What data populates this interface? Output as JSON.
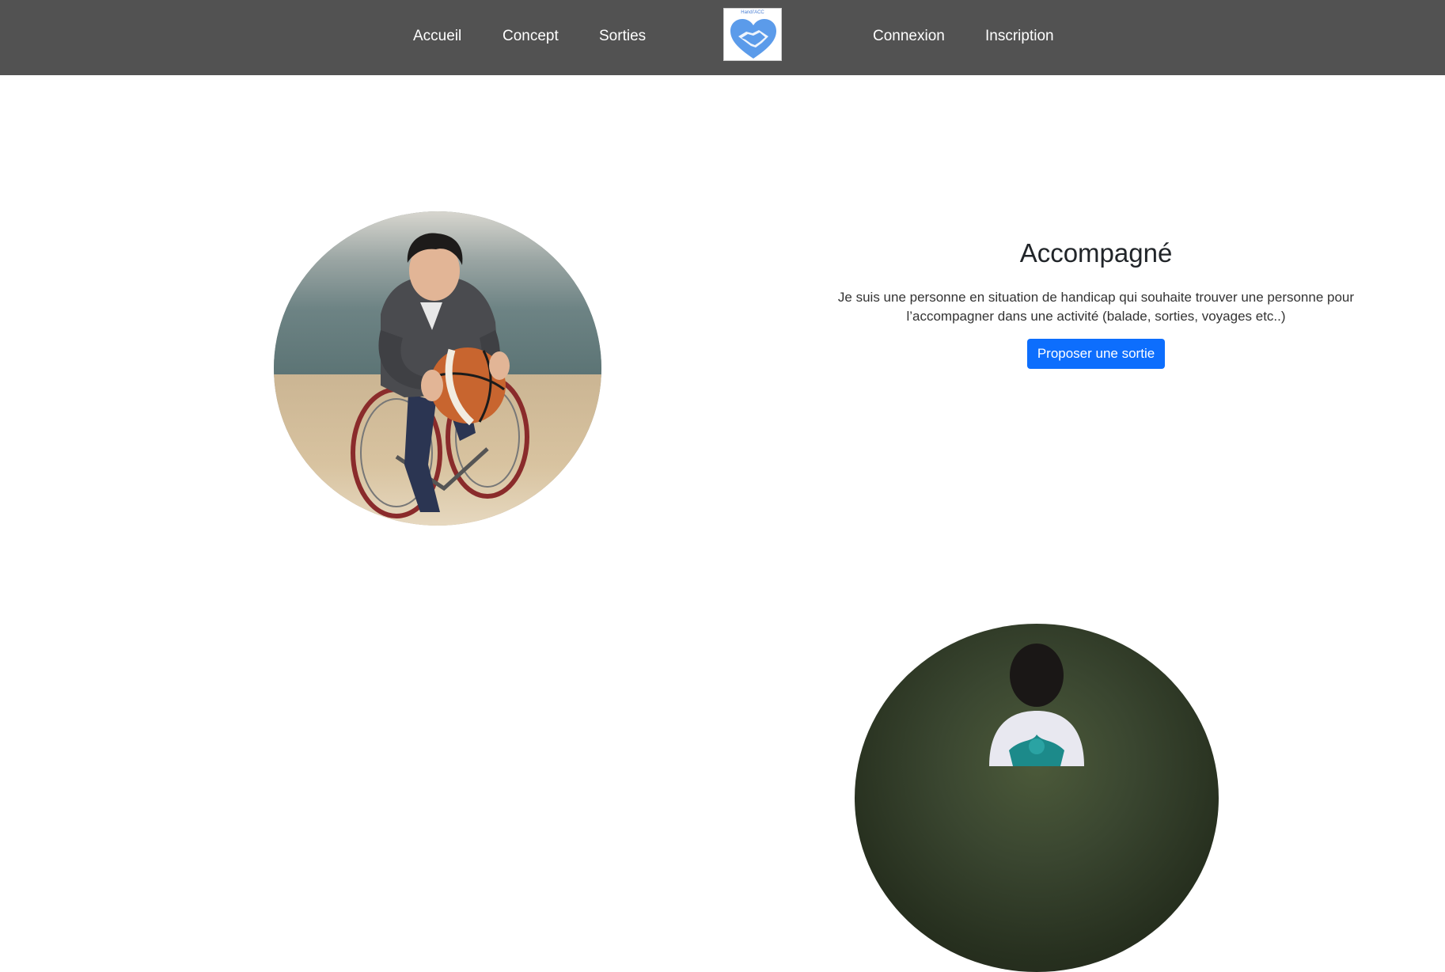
{
  "nav": {
    "left_items": [
      {
        "label": "Accueil"
      },
      {
        "label": "Concept"
      },
      {
        "label": "Sorties"
      }
    ],
    "logo": {
      "text": "Handi'ACC",
      "icon": "heart-handshake-icon"
    },
    "right_items": [
      {
        "label": "Connexion"
      },
      {
        "label": "Inscription"
      }
    ]
  },
  "section1": {
    "image": "photo-wheelchair-basketball",
    "title": "Accompagné",
    "description": "Je suis une personne en situation de handicap qui souhaite trouver une personne pour l’accompagner dans une activité (balade, sorties, voyages etc..)",
    "button_label": "Proposer une sortie"
  },
  "section2": {
    "image": "photo-person-back-view"
  },
  "colors": {
    "navbar_bg": "#525252",
    "nav_text": "#ffffff",
    "primary_button": "#0d6efd",
    "logo_heart": "#5b9bea"
  }
}
